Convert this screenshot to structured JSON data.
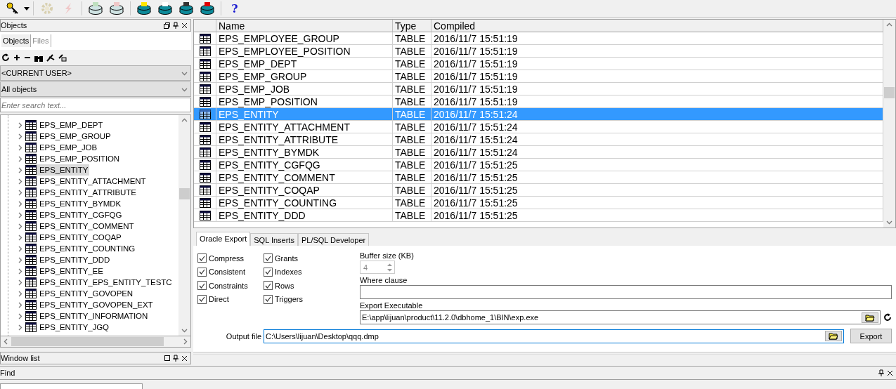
{
  "toolbar": {
    "help": "?"
  },
  "objects_panel": {
    "title": "Objects",
    "tabs": [
      {
        "label": "Objects",
        "selected": true
      },
      {
        "label": "Files",
        "selected": false
      }
    ],
    "owner": "<CURRENT USER>",
    "filter": "All objects",
    "search": {
      "placeholder": "Enter search text..."
    },
    "tree": [
      {
        "label": "EPS_EMP_DEPT",
        "selected": false
      },
      {
        "label": "EPS_EMP_GROUP",
        "selected": false
      },
      {
        "label": "EPS_EMP_JOB",
        "selected": false
      },
      {
        "label": "EPS_EMP_POSITION",
        "selected": false
      },
      {
        "label": "EPS_ENTITY",
        "selected": true
      },
      {
        "label": "EPS_ENTITY_ATTACHMENT",
        "selected": false
      },
      {
        "label": "EPS_ENTITY_ATTRIBUTE",
        "selected": false
      },
      {
        "label": "EPS_ENTITY_BYMDK",
        "selected": false
      },
      {
        "label": "EPS_ENTITY_CGFQG",
        "selected": false
      },
      {
        "label": "EPS_ENTITY_COMMENT",
        "selected": false
      },
      {
        "label": "EPS_ENTITY_COQAP",
        "selected": false
      },
      {
        "label": "EPS_ENTITY_COUNTING",
        "selected": false
      },
      {
        "label": "EPS_ENTITY_DDD",
        "selected": false
      },
      {
        "label": "EPS_ENTITY_EE",
        "selected": false
      },
      {
        "label": "EPS_ENTITY_EPS_ENTITY_TESTC",
        "selected": false
      },
      {
        "label": "EPS_ENTITY_GOVOPEN",
        "selected": false
      },
      {
        "label": "EPS_ENTITY_GOVOPEN_EXT",
        "selected": false
      },
      {
        "label": "EPS_ENTITY_INFORMATION",
        "selected": false
      },
      {
        "label": "EPS_ENTITY_JGQ",
        "selected": false
      }
    ]
  },
  "window_list": {
    "title": "Window list"
  },
  "find": {
    "title": "Find"
  },
  "table": {
    "columns": [
      "Name",
      "Type",
      "Compiled"
    ],
    "rows": [
      {
        "name": "EPS_EMPLOYEE_GROUP",
        "type": "TABLE",
        "compiled": "2016/11/7 15:51:19",
        "selected": false
      },
      {
        "name": "EPS_EMPLOYEE_POSITION",
        "type": "TABLE",
        "compiled": "2016/11/7 15:51:19",
        "selected": false
      },
      {
        "name": "EPS_EMP_DEPT",
        "type": "TABLE",
        "compiled": "2016/11/7 15:51:19",
        "selected": false
      },
      {
        "name": "EPS_EMP_GROUP",
        "type": "TABLE",
        "compiled": "2016/11/7 15:51:19",
        "selected": false
      },
      {
        "name": "EPS_EMP_JOB",
        "type": "TABLE",
        "compiled": "2016/11/7 15:51:19",
        "selected": false
      },
      {
        "name": "EPS_EMP_POSITION",
        "type": "TABLE",
        "compiled": "2016/11/7 15:51:19",
        "selected": false
      },
      {
        "name": "EPS_ENTITY",
        "type": "TABLE",
        "compiled": "2016/11/7 15:51:24",
        "selected": true
      },
      {
        "name": "EPS_ENTITY_ATTACHMENT",
        "type": "TABLE",
        "compiled": "2016/11/7 15:51:24",
        "selected": false
      },
      {
        "name": "EPS_ENTITY_ATTRIBUTE",
        "type": "TABLE",
        "compiled": "2016/11/7 15:51:24",
        "selected": false
      },
      {
        "name": "EPS_ENTITY_BYMDK",
        "type": "TABLE",
        "compiled": "2016/11/7 15:51:24",
        "selected": false
      },
      {
        "name": "EPS_ENTITY_CGFQG",
        "type": "TABLE",
        "compiled": "2016/11/7 15:51:25",
        "selected": false
      },
      {
        "name": "EPS_ENTITY_COMMENT",
        "type": "TABLE",
        "compiled": "2016/11/7 15:51:25",
        "selected": false
      },
      {
        "name": "EPS_ENTITY_COQAP",
        "type": "TABLE",
        "compiled": "2016/11/7 15:51:25",
        "selected": false
      },
      {
        "name": "EPS_ENTITY_COUNTING",
        "type": "TABLE",
        "compiled": "2016/11/7 15:51:25",
        "selected": false
      },
      {
        "name": "EPS_ENTITY_DDD",
        "type": "TABLE",
        "compiled": "2016/11/7 15:51:25",
        "selected": false
      }
    ]
  },
  "export": {
    "tabs": [
      {
        "label": "Oracle Export",
        "selected": true
      },
      {
        "label": "SQL Inserts",
        "selected": false
      },
      {
        "label": "PL/SQL Developer",
        "selected": false
      }
    ],
    "options": [
      {
        "label": "Compress",
        "checked": true
      },
      {
        "label": "Consistent",
        "checked": true
      },
      {
        "label": "Constraints",
        "checked": true
      },
      {
        "label": "Direct",
        "checked": true
      },
      {
        "label": "Grants",
        "checked": true
      },
      {
        "label": "Indexes",
        "checked": true
      },
      {
        "label": "Rows",
        "checked": true
      },
      {
        "label": "Triggers",
        "checked": true
      }
    ],
    "buffer_size": {
      "label": "Buffer size (KB)",
      "value": "4"
    },
    "where_clause": {
      "label": "Where clause"
    },
    "executable": {
      "label": "Export Executable",
      "value": "E:\\app\\lijuan\\product\\11.2.0\\dbhome_1\\BIN\\exp.exe"
    },
    "output_file": {
      "label": "Output file",
      "value": "C:\\Users\\lijuan\\Desktop\\qqq.dmp"
    },
    "export_button": "Export"
  }
}
